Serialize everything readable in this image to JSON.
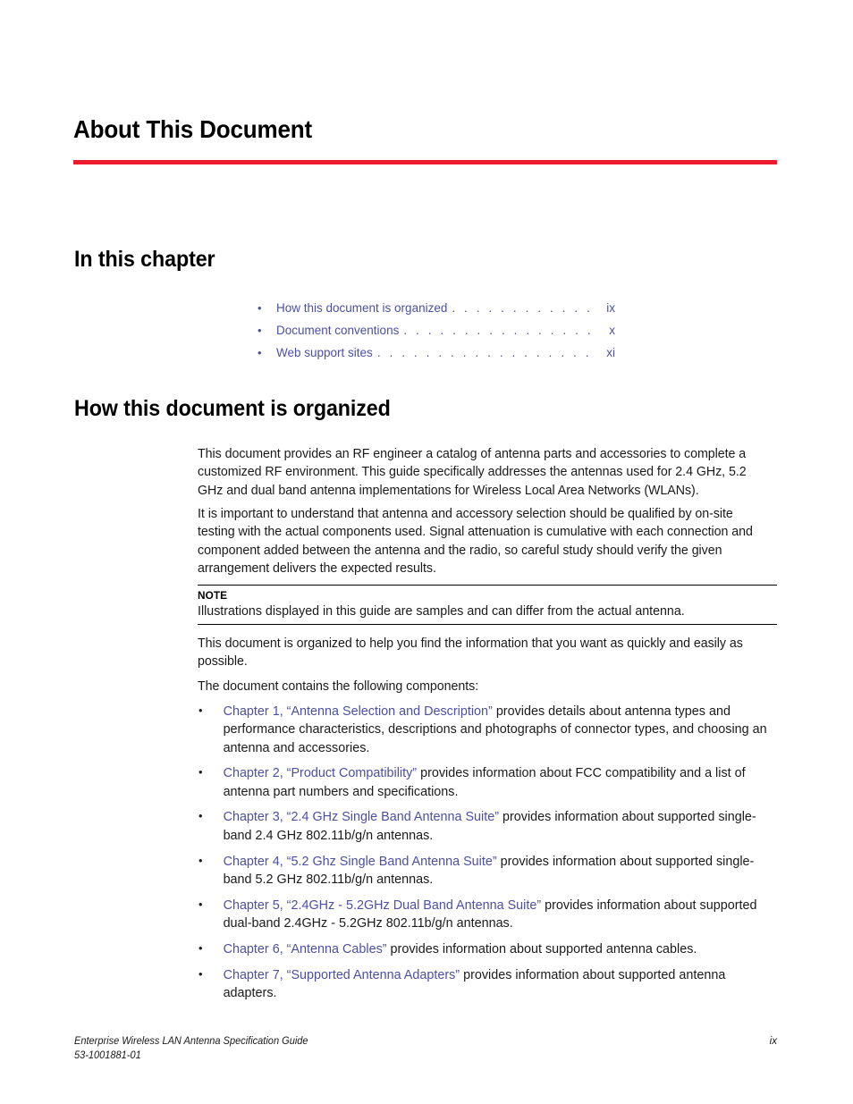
{
  "document": {
    "title": "About This Document",
    "accent_rule_color": "#ed1b2e",
    "link_color": "#4b4fa5"
  },
  "sections": {
    "in_this_chapter_heading": "In this chapter",
    "how_organized_heading": "How this document is organized"
  },
  "toc": {
    "bullet": "•",
    "leader": ". . . . . . . . . . . . . . . . . . . . . . . . . . . . . . . . . . . . . . . . . . . . . . . . . . .",
    "items": [
      {
        "label": "How this document is organized",
        "page": "ix"
      },
      {
        "label": "Document conventions",
        "page": "x"
      },
      {
        "label": "Web support sites",
        "page": "xi"
      }
    ]
  },
  "body": {
    "para_intro": "This document provides an RF engineer a catalog of antenna parts and accessories to complete a customized RF environment. This guide specifically addresses the antennas used for 2.4 GHz, 5.2 GHz and dual band antenna implementations for Wireless Local Area Networks (WLANs).",
    "para_qualify": "It is important to understand that antenna and accessory selection should be qualified by on-site testing with the actual components used. Signal attenuation is cumulative with each connection and component added between the antenna and the radio, so careful study should verify the given arrangement delivers the expected results.",
    "para_findinfo": "This document is organized to help you find the information that you want as quickly and easily as possible.",
    "para_contains": "The document contains the following components:"
  },
  "note": {
    "label": "NOTE",
    "text": "Illustrations displayed in this guide are samples and can differ from the actual antenna."
  },
  "chapters": {
    "bullet": "•",
    "items": [
      {
        "link": "Chapter 1, “Antenna Selection and Description”",
        "rest": " provides details about antenna types and performance characteristics, descriptions and photographs of connector types, and choosing an antenna and accessories."
      },
      {
        "link": "Chapter 2, “Product Compatibility”",
        "rest": " provides information about FCC compatibility and a list of antenna part numbers and specifications."
      },
      {
        "link": "Chapter 3, “2.4 GHz Single Band Antenna Suite”",
        "rest": " provides information about supported single-band 2.4 GHz 802.11b/g/n antennas."
      },
      {
        "link": "Chapter 4, “5.2 Ghz Single Band Antenna Suite”",
        "rest": " provides information about supported single-band 5.2 GHz 802.11b/g/n antennas."
      },
      {
        "link": "Chapter 5, “2.4GHz - 5.2GHz Dual Band Antenna Suite”",
        "rest": " provides information about supported dual-band 2.4GHz - 5.2GHz 802.11b/g/n antennas."
      },
      {
        "link": "Chapter 6, “Antenna Cables”",
        "rest": " provides information about supported antenna cables."
      },
      {
        "link": "Chapter 7, “Supported Antenna Adapters”",
        "rest": " provides information about supported antenna adapters."
      }
    ]
  },
  "footer": {
    "guide_title": "Enterprise Wireless LAN Antenna Specification Guide",
    "part_number": "53-1001881-01",
    "page_number": "ix"
  }
}
